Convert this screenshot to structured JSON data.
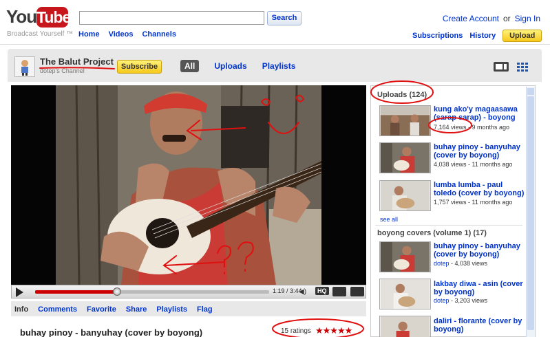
{
  "header": {
    "logo_you": "You",
    "logo_tube": "Tube",
    "tagline": "Broadcast Yourself ™",
    "search": {
      "placeholder": "",
      "button": "Search"
    },
    "nav": [
      "Home",
      "Videos",
      "Channels"
    ],
    "account": {
      "create": "Create Account",
      "or": "or",
      "signin": "Sign In"
    },
    "subnav": {
      "subscriptions": "Subscriptions",
      "history": "History",
      "upload": "Upload"
    }
  },
  "channel": {
    "title": "The Balut Project",
    "subtitle": "dotep's Channel",
    "subscribe": "Subscribe",
    "tabs": [
      "All",
      "Uploads",
      "Playlists"
    ],
    "active_tab": "All"
  },
  "player": {
    "time": "1:19 / 3:44",
    "progress_fraction": 0.35,
    "hq": "HQ"
  },
  "info": {
    "tabs": [
      "Info",
      "Comments",
      "Favorite",
      "Share",
      "Playlists",
      "Flag"
    ],
    "title": "buhay pinoy - banyuhay (cover by boyong)",
    "ratings": "15 ratings",
    "stars": "★★★★★"
  },
  "sidebar": {
    "uploads_header": "Uploads (124)",
    "uploads": [
      {
        "title": "kung ako'y magaasawa (sarap sarap) - boyong",
        "views": "7,164 views",
        "age": "9 months ago"
      },
      {
        "title": "buhay pinoy - banyuhay (cover by boyong)",
        "views": "4,038 views",
        "age": "11 months ago"
      },
      {
        "title": "lumba lumba - paul toledo (cover by boyong)",
        "views": "1,757 views",
        "age": "11 months ago"
      }
    ],
    "see_all": "see all",
    "playlist_header": "boyong covers (volume 1) (17)",
    "playlist": [
      {
        "title": "buhay pinoy - banyuhay (cover by boyong)",
        "owner": "dotep",
        "views": "4,038 views"
      },
      {
        "title": "lakbay diwa - asin (cover by boyong)",
        "owner": "dotep",
        "views": "3,203 views"
      },
      {
        "title": "daliri - florante (cover by boyong)",
        "owner": "",
        "views": ""
      }
    ]
  },
  "colors": {
    "link": "#0033cc",
    "brand_red": "#c8161d",
    "upload_yellow": "#f7c81b",
    "annotation_red": "#e01010"
  }
}
